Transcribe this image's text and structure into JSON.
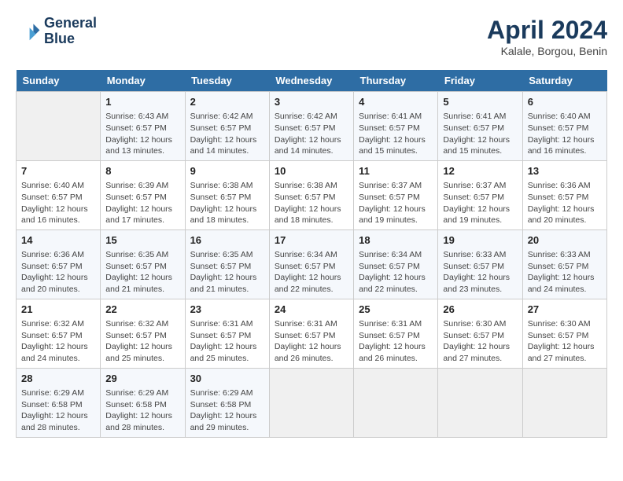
{
  "header": {
    "logo_line1": "General",
    "logo_line2": "Blue",
    "month_year": "April 2024",
    "location": "Kalale, Borgou, Benin"
  },
  "days_of_week": [
    "Sunday",
    "Monday",
    "Tuesday",
    "Wednesday",
    "Thursday",
    "Friday",
    "Saturday"
  ],
  "weeks": [
    [
      {
        "num": "",
        "info": ""
      },
      {
        "num": "1",
        "info": "Sunrise: 6:43 AM\nSunset: 6:57 PM\nDaylight: 12 hours\nand 13 minutes."
      },
      {
        "num": "2",
        "info": "Sunrise: 6:42 AM\nSunset: 6:57 PM\nDaylight: 12 hours\nand 14 minutes."
      },
      {
        "num": "3",
        "info": "Sunrise: 6:42 AM\nSunset: 6:57 PM\nDaylight: 12 hours\nand 14 minutes."
      },
      {
        "num": "4",
        "info": "Sunrise: 6:41 AM\nSunset: 6:57 PM\nDaylight: 12 hours\nand 15 minutes."
      },
      {
        "num": "5",
        "info": "Sunrise: 6:41 AM\nSunset: 6:57 PM\nDaylight: 12 hours\nand 15 minutes."
      },
      {
        "num": "6",
        "info": "Sunrise: 6:40 AM\nSunset: 6:57 PM\nDaylight: 12 hours\nand 16 minutes."
      }
    ],
    [
      {
        "num": "7",
        "info": "Sunrise: 6:40 AM\nSunset: 6:57 PM\nDaylight: 12 hours\nand 16 minutes."
      },
      {
        "num": "8",
        "info": "Sunrise: 6:39 AM\nSunset: 6:57 PM\nDaylight: 12 hours\nand 17 minutes."
      },
      {
        "num": "9",
        "info": "Sunrise: 6:38 AM\nSunset: 6:57 PM\nDaylight: 12 hours\nand 18 minutes."
      },
      {
        "num": "10",
        "info": "Sunrise: 6:38 AM\nSunset: 6:57 PM\nDaylight: 12 hours\nand 18 minutes."
      },
      {
        "num": "11",
        "info": "Sunrise: 6:37 AM\nSunset: 6:57 PM\nDaylight: 12 hours\nand 19 minutes."
      },
      {
        "num": "12",
        "info": "Sunrise: 6:37 AM\nSunset: 6:57 PM\nDaylight: 12 hours\nand 19 minutes."
      },
      {
        "num": "13",
        "info": "Sunrise: 6:36 AM\nSunset: 6:57 PM\nDaylight: 12 hours\nand 20 minutes."
      }
    ],
    [
      {
        "num": "14",
        "info": "Sunrise: 6:36 AM\nSunset: 6:57 PM\nDaylight: 12 hours\nand 20 minutes."
      },
      {
        "num": "15",
        "info": "Sunrise: 6:35 AM\nSunset: 6:57 PM\nDaylight: 12 hours\nand 21 minutes."
      },
      {
        "num": "16",
        "info": "Sunrise: 6:35 AM\nSunset: 6:57 PM\nDaylight: 12 hours\nand 21 minutes."
      },
      {
        "num": "17",
        "info": "Sunrise: 6:34 AM\nSunset: 6:57 PM\nDaylight: 12 hours\nand 22 minutes."
      },
      {
        "num": "18",
        "info": "Sunrise: 6:34 AM\nSunset: 6:57 PM\nDaylight: 12 hours\nand 22 minutes."
      },
      {
        "num": "19",
        "info": "Sunrise: 6:33 AM\nSunset: 6:57 PM\nDaylight: 12 hours\nand 23 minutes."
      },
      {
        "num": "20",
        "info": "Sunrise: 6:33 AM\nSunset: 6:57 PM\nDaylight: 12 hours\nand 24 minutes."
      }
    ],
    [
      {
        "num": "21",
        "info": "Sunrise: 6:32 AM\nSunset: 6:57 PM\nDaylight: 12 hours\nand 24 minutes."
      },
      {
        "num": "22",
        "info": "Sunrise: 6:32 AM\nSunset: 6:57 PM\nDaylight: 12 hours\nand 25 minutes."
      },
      {
        "num": "23",
        "info": "Sunrise: 6:31 AM\nSunset: 6:57 PM\nDaylight: 12 hours\nand 25 minutes."
      },
      {
        "num": "24",
        "info": "Sunrise: 6:31 AM\nSunset: 6:57 PM\nDaylight: 12 hours\nand 26 minutes."
      },
      {
        "num": "25",
        "info": "Sunrise: 6:31 AM\nSunset: 6:57 PM\nDaylight: 12 hours\nand 26 minutes."
      },
      {
        "num": "26",
        "info": "Sunrise: 6:30 AM\nSunset: 6:57 PM\nDaylight: 12 hours\nand 27 minutes."
      },
      {
        "num": "27",
        "info": "Sunrise: 6:30 AM\nSunset: 6:57 PM\nDaylight: 12 hours\nand 27 minutes."
      }
    ],
    [
      {
        "num": "28",
        "info": "Sunrise: 6:29 AM\nSunset: 6:58 PM\nDaylight: 12 hours\nand 28 minutes."
      },
      {
        "num": "29",
        "info": "Sunrise: 6:29 AM\nSunset: 6:58 PM\nDaylight: 12 hours\nand 28 minutes."
      },
      {
        "num": "30",
        "info": "Sunrise: 6:29 AM\nSunset: 6:58 PM\nDaylight: 12 hours\nand 29 minutes."
      },
      {
        "num": "",
        "info": ""
      },
      {
        "num": "",
        "info": ""
      },
      {
        "num": "",
        "info": ""
      },
      {
        "num": "",
        "info": ""
      }
    ]
  ]
}
